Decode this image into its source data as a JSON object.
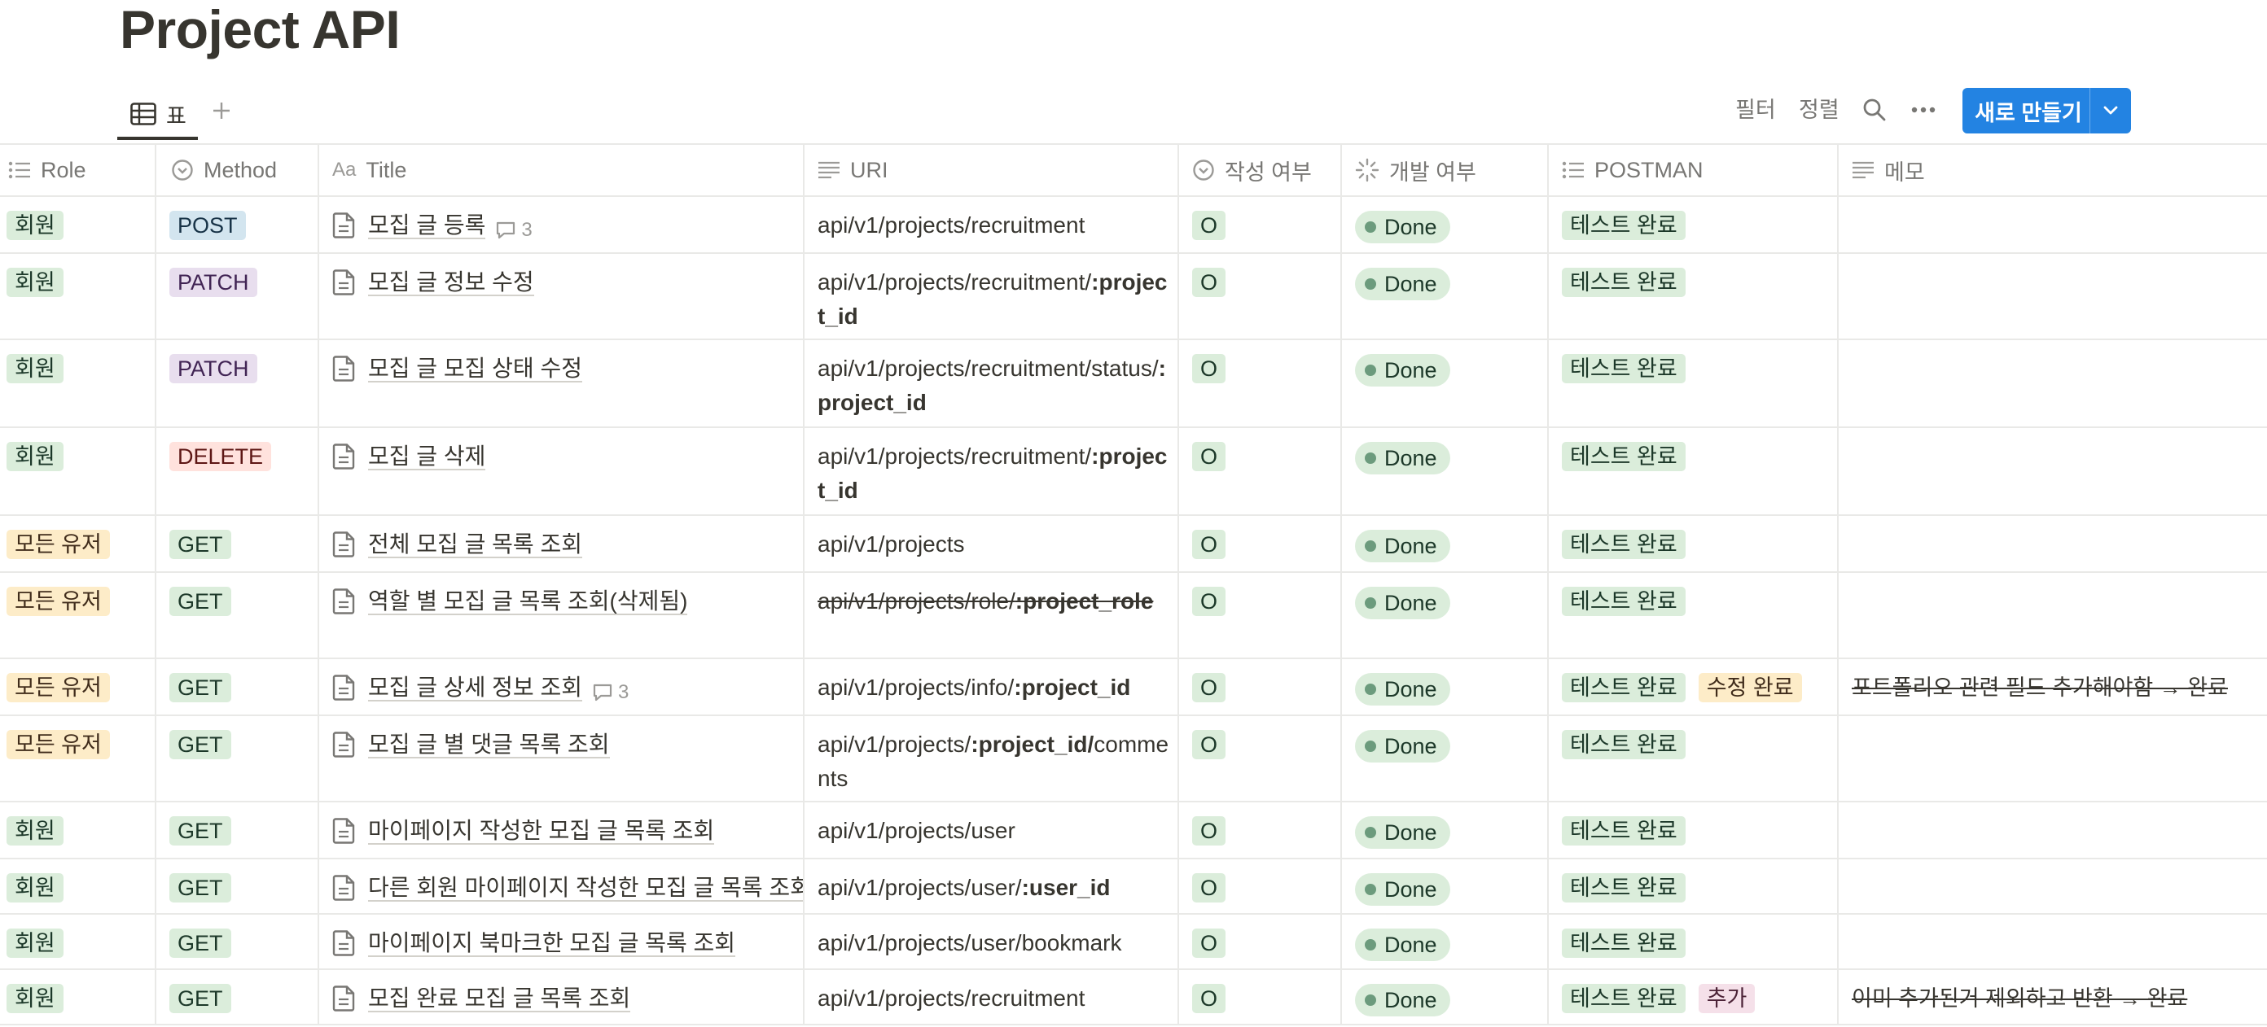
{
  "page": {
    "title": "Project API"
  },
  "view": {
    "tab_label": "표"
  },
  "toolbar": {
    "filter": "필터",
    "sort": "정렬",
    "new_button": "새로 만들기"
  },
  "columns": [
    "Role",
    "Method",
    "Title",
    "URI",
    "작성 여부",
    "개발 여부",
    "POSTMAN",
    "메모"
  ],
  "rows": [
    {
      "role": "회원",
      "method": "POST",
      "title": "모집 글 등록",
      "comments": "3",
      "uri_plain": "api/v1/projects/recruitment",
      "uri_bold": "",
      "uri_tail": "",
      "written": "O",
      "dev": "Done",
      "postman": [
        "테스트 완료"
      ],
      "memo": ""
    },
    {
      "role": "회원",
      "method": "PATCH",
      "title": "모집 글 정보 수정",
      "comments": "",
      "uri_plain": "api/v1/projects/recruitment/",
      "uri_bold": ":project_id",
      "uri_tail": "",
      "written": "O",
      "dev": "Done",
      "postman": [
        "테스트 완료"
      ],
      "memo": ""
    },
    {
      "role": "회원",
      "method": "PATCH",
      "title": "모집 글 모집 상태 수정",
      "comments": "",
      "uri_plain": "api/v1/projects/recruitment/status/",
      "uri_bold": ":project_id",
      "uri_tail": "",
      "written": "O",
      "dev": "Done",
      "postman": [
        "테스트 완료"
      ],
      "memo": ""
    },
    {
      "role": "회원",
      "method": "DELETE",
      "title": "모집 글 삭제",
      "comments": "",
      "uri_plain": "api/v1/projects/recruitment/",
      "uri_bold": ":project_id",
      "uri_tail": "",
      "written": "O",
      "dev": "Done",
      "postman": [
        "테스트 완료"
      ],
      "memo": ""
    },
    {
      "role": "모든 유저",
      "method": "GET",
      "title": "전체 모집 글 목록 조회",
      "comments": "",
      "uri_plain": "api/v1/projects",
      "uri_bold": "",
      "uri_tail": "",
      "written": "O",
      "dev": "Done",
      "postman": [
        "테스트 완료"
      ],
      "memo": ""
    },
    {
      "role": "모든 유저",
      "method": "GET",
      "title": "역할 별 모집 글 목록 조회(삭제됨)",
      "comments": "",
      "uri_plain": "api/v1/projects/role/",
      "uri_bold": ":project_role",
      "uri_tail": "",
      "written": "O",
      "dev": "Done",
      "postman": [
        "테스트 완료"
      ],
      "memo": ""
    },
    {
      "role": "모든 유저",
      "method": "GET",
      "title": "모집 글 상세 정보 조회",
      "comments": "3",
      "uri_plain": "api/v1/projects/info/",
      "uri_bold": ":project_id",
      "uri_tail": "",
      "written": "O",
      "dev": "Done",
      "postman": [
        "테스트 완료",
        "수정 완료"
      ],
      "memo": "포트폴리오 관련 필드 추가해야함 → 완료"
    },
    {
      "role": "모든 유저",
      "method": "GET",
      "title": "모집 글 별 댓글 목록 조회",
      "comments": "",
      "uri_plain": "api/v1/projects/",
      "uri_bold": ":project_id/",
      "uri_tail": "comments",
      "written": "O",
      "dev": "Done",
      "postman": [
        "테스트 완료"
      ],
      "memo": ""
    },
    {
      "role": "회원",
      "method": "GET",
      "title": "마이페이지 작성한 모집 글 목록 조회",
      "comments": "",
      "uri_plain": "api/v1/projects/user",
      "uri_bold": "",
      "uri_tail": "",
      "written": "O",
      "dev": "Done",
      "postman": [
        "테스트 완료"
      ],
      "memo": ""
    },
    {
      "role": "회원",
      "method": "GET",
      "title": "다른 회원 마이페이지 작성한 모집 글 목록 조회",
      "comments": "",
      "uri_plain": "api/v1/projects/user/",
      "uri_bold": ":user_id",
      "uri_tail": "",
      "written": "O",
      "dev": "Done",
      "postman": [
        "테스트 완료"
      ],
      "memo": ""
    },
    {
      "role": "회원",
      "method": "GET",
      "title": "마이페이지 북마크한 모집 글 목록 조회",
      "comments": "",
      "uri_plain": "api/v1/projects/user/bookmark",
      "uri_bold": "",
      "uri_tail": "",
      "written": "O",
      "dev": "Done",
      "postman": [
        "테스트 완료"
      ],
      "memo": ""
    },
    {
      "role": "회원",
      "method": "GET",
      "title": "모집 완료 모집 글 목록 조회",
      "comments": "",
      "uri_plain": "api/v1/projects/recruitment",
      "uri_bold": "",
      "uri_tail": "",
      "written": "O",
      "dev": "Done",
      "postman": [
        "테스트 완료",
        "추가"
      ],
      "memo": "이미 추가된거 제외하고 반환 → 완료"
    }
  ],
  "colors": {
    "primary_button": "#2383e2",
    "role_member": "#dbeddb",
    "role_all_users": "#fdecc8",
    "method_post": "#d3e5ef",
    "method_patch": "#e8deee",
    "method_delete": "#ffe2dd",
    "method_get": "#dbeddb",
    "status_done": "#dbeddb"
  },
  "icons": {
    "view_tab": "table-icon",
    "add_view": "plus-icon",
    "search": "search-icon",
    "more": "more-icon",
    "new_dropdown": "chevron-down-icon",
    "title_page": "document-icon",
    "comment": "comment-icon"
  }
}
